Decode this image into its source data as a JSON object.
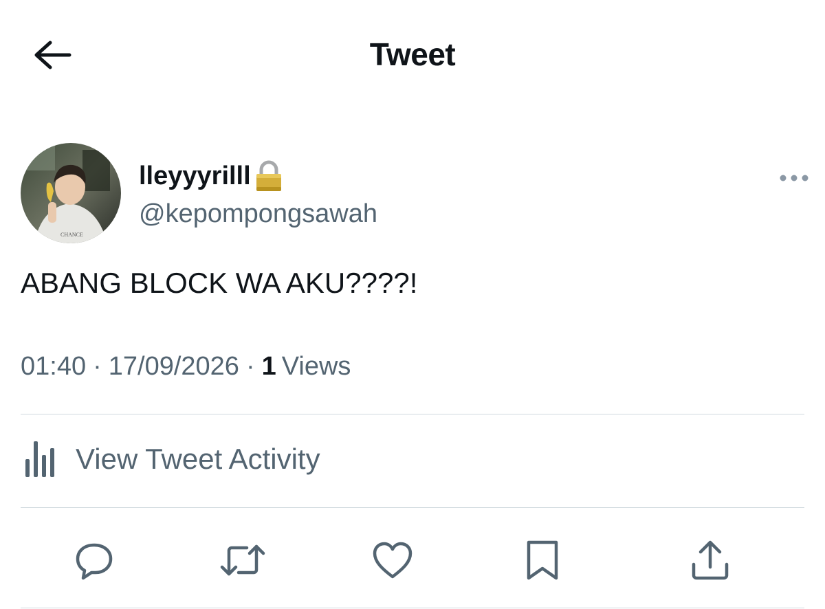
{
  "header": {
    "title": "Tweet",
    "back_icon": "arrow-left-icon"
  },
  "author": {
    "display_name": "lleyyyrilll",
    "protected_icon": "lock-icon",
    "handle": "@kepompongsawah",
    "avatar_shirt_text": "CHANCE"
  },
  "tweet": {
    "text": "ABANG BLOCK WA AKU????!"
  },
  "meta": {
    "time": "01:40",
    "separator": "·",
    "date": "17/09/2026",
    "views_count": "1",
    "views_label": "Views"
  },
  "activity": {
    "label": "View Tweet Activity",
    "icon": "bar-chart-icon"
  },
  "actions": [
    "reply-icon",
    "retweet-icon",
    "like-icon",
    "bookmark-icon",
    "share-icon"
  ],
  "colors": {
    "text": "#0f1419",
    "secondary": "#536471",
    "divider": "#cfd9de",
    "lock": "#c9a227"
  }
}
